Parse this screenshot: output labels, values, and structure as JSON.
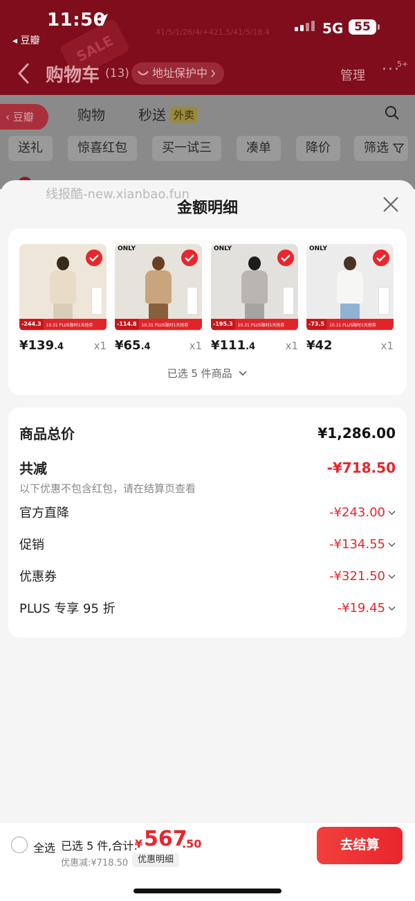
{
  "status_bar": {
    "time": "11:50",
    "back_app": "◂ 豆瓣",
    "network": "5G",
    "battery": "55",
    "faint_text": "41/5/1/26/4/+421.5/41/5/18.4"
  },
  "background_page": {
    "title": "购物车",
    "count": "(13)",
    "address_chip": "地址保护中",
    "manage": "管理",
    "more": "···",
    "more_badge": "5+",
    "douban_tag": "豆瓣",
    "tabs": [
      {
        "label": "购物"
      },
      {
        "label": "秒送"
      }
    ],
    "waimai_badge": "外卖",
    "filters": [
      {
        "label": "送礼"
      },
      {
        "label": "惊喜红包"
      },
      {
        "label": "买一试三"
      },
      {
        "label": "凑单"
      },
      {
        "label": "降价"
      },
      {
        "label": "筛选"
      }
    ],
    "sale_tag": "SALE"
  },
  "watermark": "线报酷-new.xianbao.fun",
  "sheet": {
    "title": "金额明细",
    "products": [
      {
        "brand": "",
        "price_int": "¥139",
        "price_dec": ".4",
        "qty": "x1",
        "strip_price": "-244.3",
        "promo": "10.31 PLUS限时1天抢券",
        "body_color": "#e8dcc8",
        "bg": "#efe6da",
        "hair": "#3a2a1c",
        "legs": "#d9cdb8"
      },
      {
        "brand": "ONLY",
        "price_int": "¥65",
        "price_dec": ".4",
        "qty": "x1",
        "strip_price": "-114.8",
        "promo": "10.31 PLUS限时1天抢券",
        "body_color": "#c9a57d",
        "bg": "#e6e2dc",
        "hair": "#6b3f24",
        "legs": "#8a5f3c"
      },
      {
        "brand": "ONLY",
        "price_int": "¥111",
        "price_dec": ".4",
        "qty": "x1",
        "strip_price": "-195.3",
        "promo": "10.31 PLUS限时1天抢券",
        "body_color": "#b9b6b2",
        "bg": "#e3e1de",
        "hair": "#1c1c1c",
        "legs": "#a7a3a0"
      },
      {
        "brand": "ONLY",
        "price_int": "¥42",
        "price_dec": "",
        "qty": "x1",
        "strip_price": "-73.5",
        "promo": "10.31 PLUS限时1天抢券",
        "body_color": "#f6f6f4",
        "bg": "#ececec",
        "hair": "#4a3322",
        "legs": "#8fb3d2"
      }
    ],
    "selected_text": "已选 5 件商品",
    "summary": {
      "total_label": "商品总价",
      "total_value": "¥1,286.00",
      "reduce_label": "共减",
      "reduce_value": "-¥718.50",
      "note": "以下优惠不包含红包，请在结算页查看",
      "items": [
        {
          "label": "官方直降",
          "value": "-¥243.00"
        },
        {
          "label": "促销",
          "value": "-¥134.55"
        },
        {
          "label": "优惠券",
          "value": "-¥321.50"
        },
        {
          "label": "PLUS 专享 95 折",
          "value": "-¥19.45"
        }
      ]
    }
  },
  "bottom_bar": {
    "select_all": "全选",
    "selected_count": "已选 5 件,合计:",
    "total_symbol": "¥",
    "total_int": "567",
    "total_dec": ".50",
    "discount": "优惠减:¥718.50",
    "detail_chip": "优惠明细",
    "checkout": "去结算"
  },
  "colors": {
    "accent": "#e8262c",
    "header_bg": "#7f0d1b"
  }
}
